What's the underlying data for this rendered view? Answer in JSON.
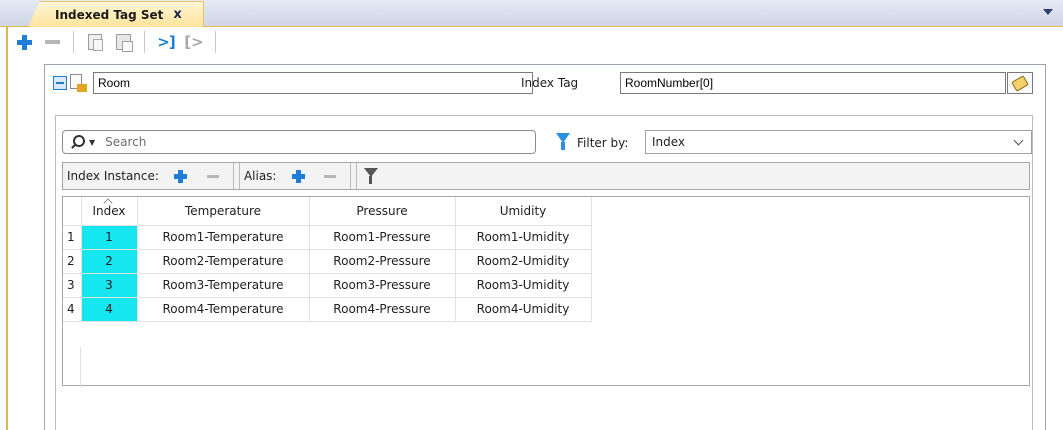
{
  "tab": {
    "title": "Indexed Tag Set",
    "close": "x"
  },
  "toolbar": {
    "add": "add",
    "remove": "remove",
    "copy": "copy",
    "paste": "paste",
    "import": "import",
    "export": "export"
  },
  "set": {
    "name": "Room",
    "index_tag_label": "Index Tag",
    "index_tag_value": "RoomNumber[0]"
  },
  "search": {
    "placeholder": "Search"
  },
  "filter": {
    "label": "Filter by:",
    "selected": "Index"
  },
  "instance_bar": {
    "index_instance_label": "Index Instance:",
    "alias_label": "Alias:"
  },
  "table": {
    "columns": [
      "Index",
      "Temperature",
      "Pressure",
      "Umidity"
    ],
    "rows": [
      {
        "num": "1",
        "index": "1",
        "temperature": "Room1-Temperature",
        "pressure": "Room1-Pressure",
        "umidity": "Room1-Umidity"
      },
      {
        "num": "2",
        "index": "2",
        "temperature": "Room2-Temperature",
        "pressure": "Room2-Pressure",
        "umidity": "Room2-Umidity"
      },
      {
        "num": "3",
        "index": "3",
        "temperature": "Room3-Temperature",
        "pressure": "Room3-Pressure",
        "umidity": "Room3-Umidity"
      },
      {
        "num": "4",
        "index": "4",
        "temperature": "Room4-Temperature",
        "pressure": "Room4-Pressure",
        "umidity": "Room4-Umidity"
      }
    ]
  },
  "colors": {
    "accent_blue": "#1e7ed6",
    "index_cell": "#15e6f0",
    "tab_active": "#ffe39b"
  }
}
